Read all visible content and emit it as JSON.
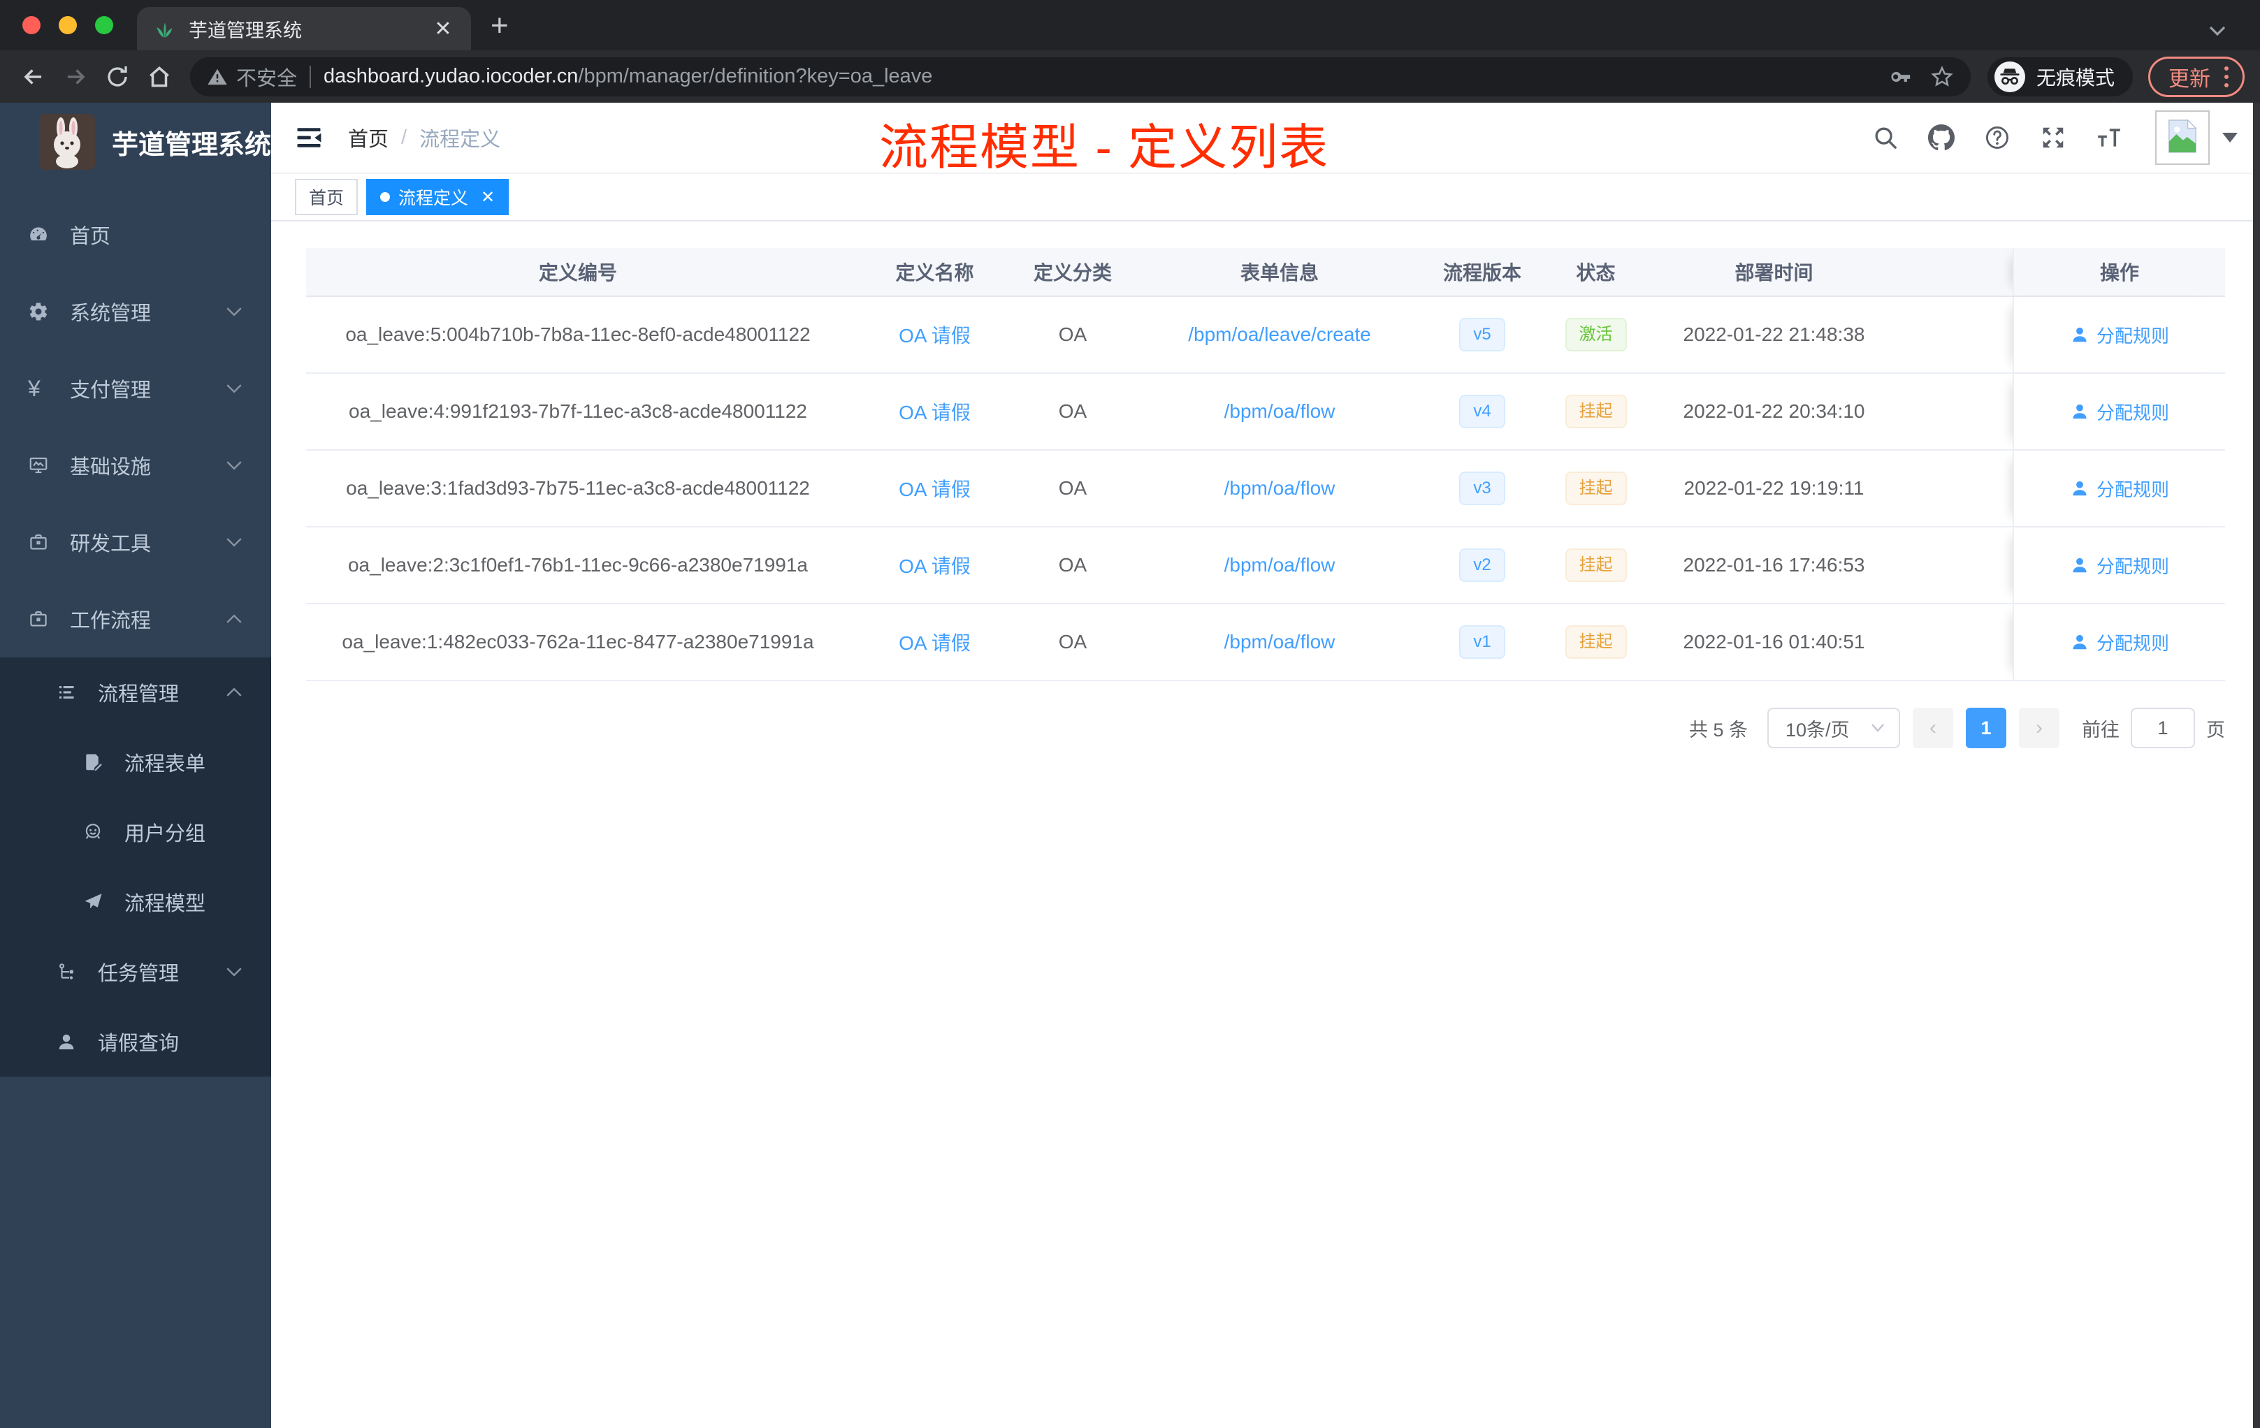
{
  "browser": {
    "tab_title": "芋道管理系统",
    "favicon": "plant-icon",
    "security_label": "不安全",
    "url_host": "dashboard.yudao.iocoder.cn",
    "url_path": "/bpm/manager/definition?key=oa_leave",
    "incognito_label": "无痕模式",
    "update_label": "更新"
  },
  "sidebar": {
    "logo_title": "芋道管理系统",
    "items": [
      {
        "label": "首页",
        "icon": "dashboard-icon",
        "chevron": "",
        "level": 1,
        "dark": false
      },
      {
        "label": "系统管理",
        "icon": "gear-icon",
        "chevron": "down",
        "level": 1,
        "dark": false
      },
      {
        "label": "支付管理",
        "icon": "yen-icon",
        "chevron": "down",
        "level": 1,
        "dark": false
      },
      {
        "label": "基础设施",
        "icon": "monitor-icon",
        "chevron": "down",
        "level": 1,
        "dark": false
      },
      {
        "label": "研发工具",
        "icon": "briefcase-icon",
        "chevron": "down",
        "level": 1,
        "dark": false
      },
      {
        "label": "工作流程",
        "icon": "briefcase-icon",
        "chevron": "up",
        "level": 1,
        "dark": false
      },
      {
        "label": "流程管理",
        "icon": "list-icon",
        "chevron": "up",
        "level": 2,
        "dark": true
      },
      {
        "label": "流程表单",
        "icon": "form-icon",
        "chevron": "",
        "level": 3,
        "dark": true
      },
      {
        "label": "用户分组",
        "icon": "user-group-icon",
        "chevron": "",
        "level": 3,
        "dark": true
      },
      {
        "label": "流程模型",
        "icon": "paper-plane-icon",
        "chevron": "",
        "level": 3,
        "dark": true
      },
      {
        "label": "任务管理",
        "icon": "tasks-icon",
        "chevron": "down",
        "level": 2,
        "dark": true
      },
      {
        "label": "请假查询",
        "icon": "person-icon",
        "chevron": "",
        "level": 2,
        "dark": true
      }
    ]
  },
  "navbar": {
    "breadcrumb_home": "首页",
    "breadcrumb_sep": "/",
    "breadcrumb_current": "流程定义",
    "annotation": "流程模型 - 定义列表",
    "annotation_color": "#ff2d00",
    "icons": [
      "search-icon",
      "github-icon",
      "question-icon",
      "fullscreen-icon",
      "font-size-icon"
    ]
  },
  "tags": [
    {
      "label": "首页",
      "active": false,
      "closable": false
    },
    {
      "label": "流程定义",
      "active": true,
      "closable": true
    }
  ],
  "table": {
    "columns": [
      "定义编号",
      "定义名称",
      "定义分类",
      "表单信息",
      "流程版本",
      "状态",
      "部署时间",
      "操作"
    ],
    "action_label": "分配规则",
    "rows": [
      {
        "id": "oa_leave:5:004b710b-7b8a-11ec-8ef0-acde48001122",
        "name": "OA 请假",
        "category": "OA",
        "form": "/bpm/oa/leave/create",
        "version": "v5",
        "status": "激活",
        "status_type": "success",
        "deploy_time": "2022-01-22 21:48:38"
      },
      {
        "id": "oa_leave:4:991f2193-7b7f-11ec-a3c8-acde48001122",
        "name": "OA 请假",
        "category": "OA",
        "form": "/bpm/oa/flow",
        "version": "v4",
        "status": "挂起",
        "status_type": "warning",
        "deploy_time": "2022-01-22 20:34:10"
      },
      {
        "id": "oa_leave:3:1fad3d93-7b75-11ec-a3c8-acde48001122",
        "name": "OA 请假",
        "category": "OA",
        "form": "/bpm/oa/flow",
        "version": "v3",
        "status": "挂起",
        "status_type": "warning",
        "deploy_time": "2022-01-22 19:19:11"
      },
      {
        "id": "oa_leave:2:3c1f0ef1-76b1-11ec-9c66-a2380e71991a",
        "name": "OA 请假",
        "category": "OA",
        "form": "/bpm/oa/flow",
        "version": "v2",
        "status": "挂起",
        "status_type": "warning",
        "deploy_time": "2022-01-16 17:46:53"
      },
      {
        "id": "oa_leave:1:482ec033-762a-11ec-8477-a2380e71991a",
        "name": "OA 请假",
        "category": "OA",
        "form": "/bpm/oa/flow",
        "version": "v1",
        "status": "挂起",
        "status_type": "warning",
        "deploy_time": "2022-01-16 01:40:51"
      }
    ]
  },
  "pagination": {
    "total_label": "共 5 条",
    "page_size_label": "10条/页",
    "current_page": "1",
    "goto_label": "前往",
    "goto_value": "1",
    "page_unit": "页"
  },
  "colors": {
    "accent_blue": "#409eff",
    "tag_active_blue": "#1890ff",
    "sidebar_bg": "#304156",
    "sidebar_submenu_bg": "#1f2d3d",
    "success_green": "#67c23a",
    "warning_orange": "#e6a23c",
    "annotation_red": "#ff2d00",
    "update_salmon": "#f28b82"
  }
}
